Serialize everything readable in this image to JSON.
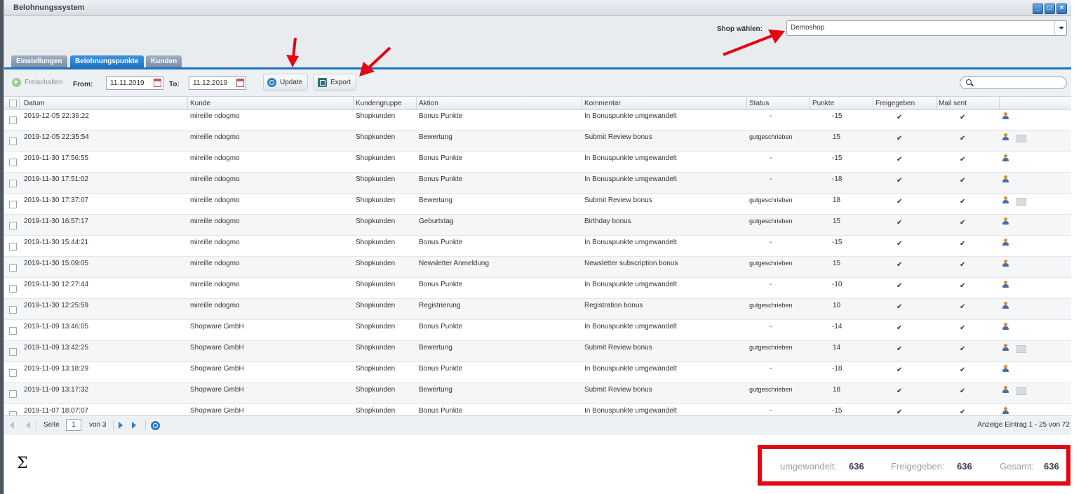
{
  "window": {
    "title": "Belohnungssystem",
    "controls": [
      "_",
      "□",
      "×"
    ]
  },
  "shop": {
    "label": "Shop wählen:",
    "value": "Demoshop"
  },
  "tabs": [
    {
      "label": "Einstellungen",
      "active": false
    },
    {
      "label": "Belohnungspunkte",
      "active": true
    },
    {
      "label": "Kunden",
      "active": false
    }
  ],
  "toolbar": {
    "release_label": "Freischalten",
    "from_label": "From:",
    "from_value": "11.11.2019",
    "to_label": "To:",
    "to_value": "11.12.2019",
    "update_label": "Update",
    "export_label": "Export",
    "search_value": ""
  },
  "grid": {
    "columns": [
      "Datum",
      "Kunde",
      "Kundengruppe",
      "Aktion",
      "Kommentar",
      "Status",
      "Punkte",
      "Freigegeben",
      "Mail sent"
    ],
    "rows": [
      {
        "date": "2019-12-05 22:36:22",
        "customer": "mireille ndogmo",
        "group": "Shopkunden",
        "action": "Bonus Punkte",
        "comment": "In Bonuspunkte umgewandelt",
        "status": "-",
        "points": "-15",
        "released": "✔",
        "mail": "✔",
        "mail_icon": false
      },
      {
        "date": "2019-12-05 22:35:54",
        "customer": "mireille ndogmo",
        "group": "Shopkunden",
        "action": "Bewertung",
        "comment": "Submit Review bonus",
        "status": "gutgeschrieben",
        "points": "15",
        "released": "✔",
        "mail": "✔",
        "mail_icon": true
      },
      {
        "date": "2019-11-30 17:56:55",
        "customer": "mireille ndogmo",
        "group": "Shopkunden",
        "action": "Bonus Punkte",
        "comment": "In Bonuspunkte umgewandelt",
        "status": "-",
        "points": "-15",
        "released": "✔",
        "mail": "✔",
        "mail_icon": false
      },
      {
        "date": "2019-11-30 17:51:02",
        "customer": "mireille ndogmo",
        "group": "Shopkunden",
        "action": "Bonus Punkte",
        "comment": "In Bonuspunkte umgewandelt",
        "status": "-",
        "points": "-18",
        "released": "✔",
        "mail": "✔",
        "mail_icon": false
      },
      {
        "date": "2019-11-30 17:37:07",
        "customer": "mireille ndogmo",
        "group": "Shopkunden",
        "action": "Bewertung",
        "comment": "Submit Review bonus",
        "status": "gutgeschrieben",
        "points": "18",
        "released": "✔",
        "mail": "✔",
        "mail_icon": true
      },
      {
        "date": "2019-11-30 16:57:17",
        "customer": "mireille ndogmo",
        "group": "Shopkunden",
        "action": "Geburtstag",
        "comment": "Birthday bonus",
        "status": "gutgeschrieben",
        "points": "15",
        "released": "✔",
        "mail": "✔",
        "mail_icon": false
      },
      {
        "date": "2019-11-30 15:44:21",
        "customer": "mireille ndogmo",
        "group": "Shopkunden",
        "action": "Bonus Punkte",
        "comment": "In Bonuspunkte umgewandelt",
        "status": "-",
        "points": "-15",
        "released": "✔",
        "mail": "✔",
        "mail_icon": false
      },
      {
        "date": "2019-11-30 15:09:05",
        "customer": "mireille ndogmo",
        "group": "Shopkunden",
        "action": "Newsletter Anmeldung",
        "comment": "Newsletter subscription bonus",
        "status": "gutgeschrieben",
        "points": "15",
        "released": "✔",
        "mail": "✔",
        "mail_icon": false
      },
      {
        "date": "2019-11-30 12:27:44",
        "customer": "mireille ndogmo",
        "group": "Shopkunden",
        "action": "Bonus Punkte",
        "comment": "In Bonuspunkte umgewandelt",
        "status": "-",
        "points": "-10",
        "released": "✔",
        "mail": "✔",
        "mail_icon": false
      },
      {
        "date": "2019-11-30 12:25:59",
        "customer": "mireille ndogmo",
        "group": "Shopkunden",
        "action": "Registrierung",
        "comment": "Registration bonus",
        "status": "gutgeschrieben",
        "points": "10",
        "released": "✔",
        "mail": "✔",
        "mail_icon": false
      },
      {
        "date": "2019-11-09 13:46:05",
        "customer": "Shopware GmbH",
        "group": "Shopkunden",
        "action": "Bonus Punkte",
        "comment": "In Bonuspunkte umgewandelt",
        "status": "-",
        "points": "-14",
        "released": "✔",
        "mail": "✔",
        "mail_icon": false
      },
      {
        "date": "2019-11-09 13:42:25",
        "customer": "Shopware GmbH",
        "group": "Shopkunden",
        "action": "Bewertung",
        "comment": "Submit Review bonus",
        "status": "gutgeschrieben",
        "points": "14",
        "released": "✔",
        "mail": "✔",
        "mail_icon": true
      },
      {
        "date": "2019-11-09 13:18:29",
        "customer": "Shopware GmbH",
        "group": "Shopkunden",
        "action": "Bonus Punkte",
        "comment": "In Bonuspunkte umgewandelt",
        "status": "-",
        "points": "-18",
        "released": "✔",
        "mail": "✔",
        "mail_icon": false
      },
      {
        "date": "2019-11-09 13:17:32",
        "customer": "Shopware GmbH",
        "group": "Shopkunden",
        "action": "Bewertung",
        "comment": "Submit Review bonus",
        "status": "gutgeschrieben",
        "points": "18",
        "released": "✔",
        "mail": "✔",
        "mail_icon": true
      },
      {
        "date": "2019-11-07 18:07:07",
        "customer": "Shopware GmbH",
        "group": "Shopkunden",
        "action": "Bonus Punkte",
        "comment": "In Bonuspunkte umgewandelt",
        "status": "-",
        "points": "-15",
        "released": "✔",
        "mail": "✔",
        "mail_icon": false
      }
    ]
  },
  "pager": {
    "page_label": "Seite",
    "page_value": "1",
    "of_label": "von 3",
    "display_info": "Anzeige Eintrag 1 - 25 von 72"
  },
  "summary": {
    "sigma": "Σ",
    "converted_label": "umgewandelt:",
    "converted_value": "636",
    "released_label": "Freigegeben:",
    "released_value": "636",
    "total_label": "Gesamt:",
    "total_value": "636"
  },
  "colors": {
    "accent": "#1d73c2",
    "highlight": "#e30613",
    "positive": "#2e7d2e",
    "negative": "#d51c1c"
  }
}
